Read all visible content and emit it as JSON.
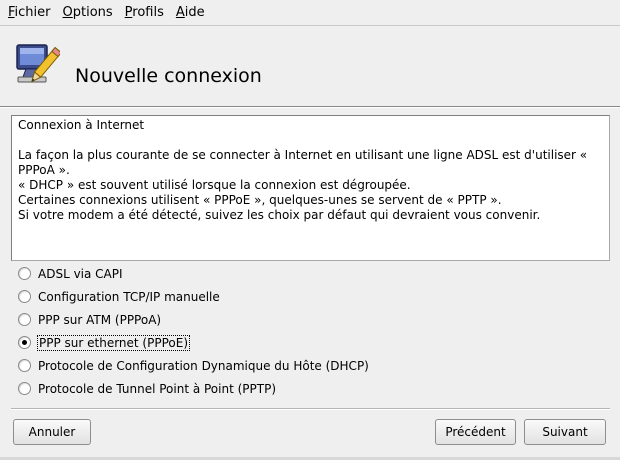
{
  "menubar": {
    "items": [
      {
        "accel": "F",
        "rest": "ichier"
      },
      {
        "accel": "O",
        "rest": "ptions"
      },
      {
        "accel": "P",
        "rest": "rofils"
      },
      {
        "accel": "A",
        "rest": "ide"
      }
    ]
  },
  "header": {
    "title": "Nouvelle connexion",
    "icon": "network-config-icon"
  },
  "description": {
    "lines": [
      "Connexion à Internet",
      "",
      "La façon la plus courante de se connecter à Internet en utilisant une ligne ADSL est d'utiliser « PPPoA ».",
      "« DHCP » est souvent utilisé lorsque la connexion est dégroupée.",
      "Certaines connexions utilisent « PPPoE », quelques-unes se servent de « PPTP ».",
      "Si votre modem a été détecté, suivez les choix par défaut qui devraient vous convenir."
    ]
  },
  "options": {
    "items": [
      {
        "label": "ADSL via CAPI",
        "checked": false
      },
      {
        "label": "Configuration TCP/IP manuelle",
        "checked": false
      },
      {
        "label": "PPP sur ATM (PPPoA)",
        "checked": false
      },
      {
        "label": "PPP sur ethernet (PPPoE)",
        "checked": true
      },
      {
        "label": "Protocole de Configuration Dynamique du Hôte (DHCP)",
        "checked": false
      },
      {
        "label": "Protocole de Tunnel Point à Point (PPTP)",
        "checked": false
      }
    ]
  },
  "buttons": {
    "cancel": "Annuler",
    "previous": "Précédent",
    "next": "Suivant"
  }
}
